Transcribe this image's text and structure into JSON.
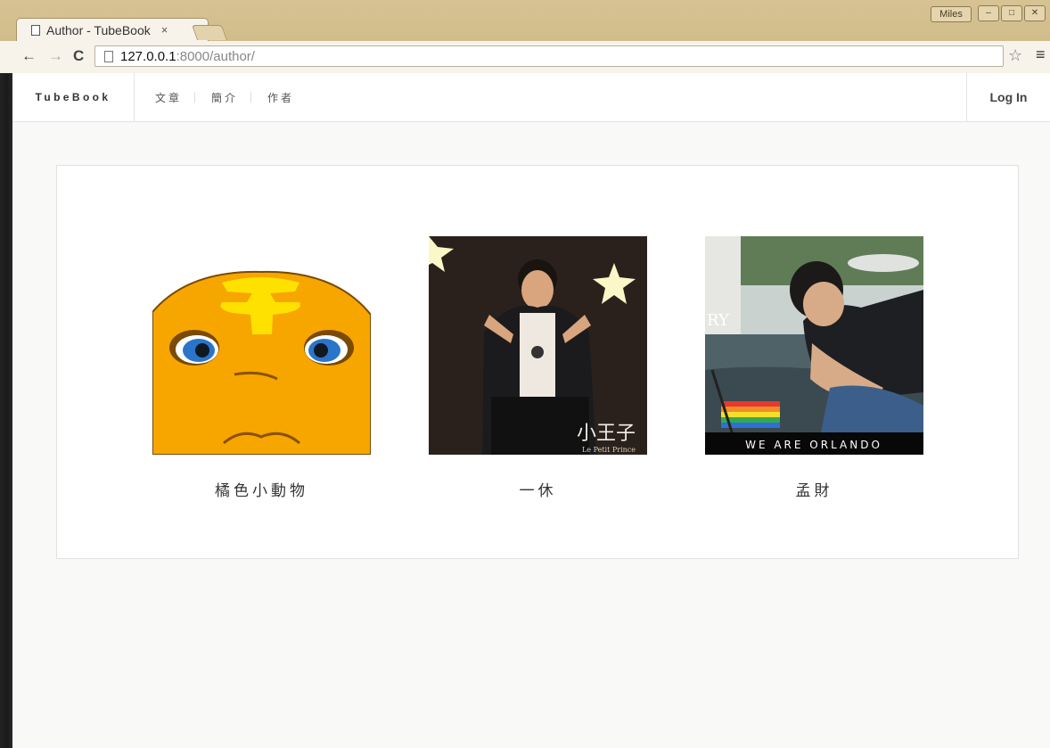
{
  "browser": {
    "tab_title": "Author - TubeBook",
    "tab_close": "×",
    "url_host": "127.0.0.1",
    "url_path": ":8000/author/",
    "user": "Miles",
    "nav_back": "←",
    "nav_forward": "→",
    "reload": "C",
    "star": "☆",
    "menu": "≡",
    "win_minimize": "–",
    "win_restore": "□",
    "win_close": "✕"
  },
  "site": {
    "brand": "TubeBook",
    "menu": [
      "文章",
      "簡介",
      "作者"
    ],
    "login": "Log In"
  },
  "authors": [
    {
      "name": "橘色小動物",
      "avatar_icon": "orange-creature-face"
    },
    {
      "name": "一休",
      "avatar_icon": "person-le-petit-prince-photo",
      "avatar_caption": "小王子",
      "avatar_subcaption": "Le Petit Prince"
    },
    {
      "name": "孟財",
      "avatar_icon": "person-rainbow-flag-photo",
      "avatar_caption": "WE ARE ORLANDO",
      "avatar_partial_text": "RY"
    }
  ],
  "colors": {
    "chrome": "#d6c292",
    "page_bg": "#f9f9f7",
    "orange": "#f7a600",
    "accent_yellow": "#ffe100"
  }
}
